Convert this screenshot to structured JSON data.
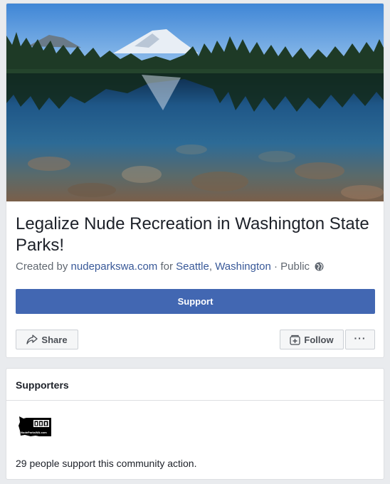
{
  "event": {
    "title": "Legalize Nude Recreation in Washington State Parks!",
    "created_by_prefix": "Created by",
    "creator_link": "nudeparkswa.com",
    "for_text": "for",
    "location_city": "Seattle",
    "location_sep": ",",
    "location_state": "Washington",
    "privacy": "· Public",
    "privacy_icon": "globe-icon"
  },
  "actions": {
    "support_label": "Support",
    "share_label": "Share",
    "follow_label": "Follow",
    "more_label": "···"
  },
  "supporters": {
    "header": "Supporters",
    "logo_text": "NudeParksWA.com",
    "summary": "29 people support this community action."
  },
  "colors": {
    "accent": "#4267b2",
    "link": "#385898",
    "page_bg": "#e9ebee"
  }
}
